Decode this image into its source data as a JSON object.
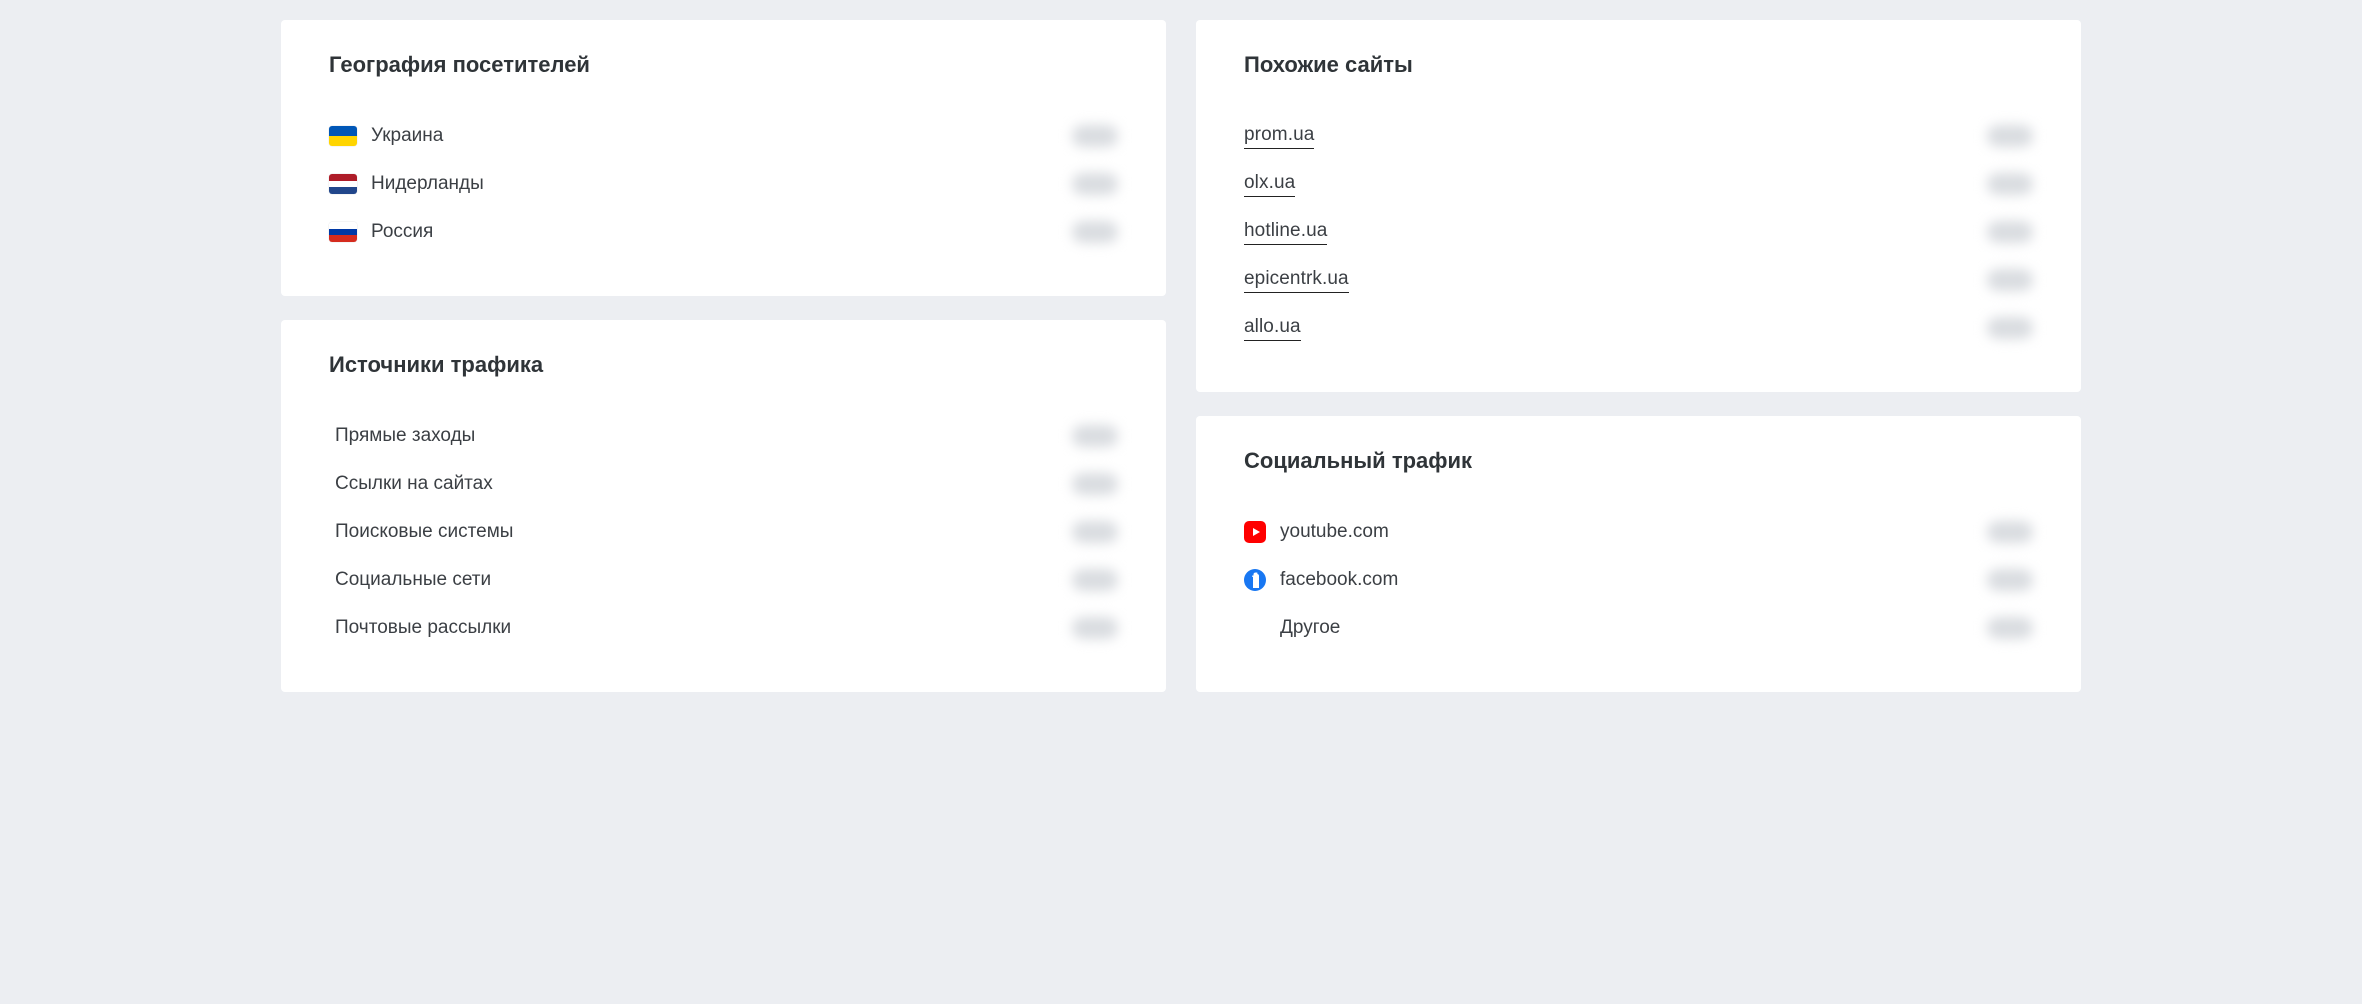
{
  "geography": {
    "title": "География посетителей",
    "items": [
      {
        "label": "Украина",
        "flag": "ua"
      },
      {
        "label": "Нидерланды",
        "flag": "nl"
      },
      {
        "label": "Россия",
        "flag": "ru"
      }
    ]
  },
  "traffic_sources": {
    "title": "Источники трафика",
    "items": [
      {
        "label": "Прямые заходы"
      },
      {
        "label": "Ссылки на сайтах"
      },
      {
        "label": "Поисковые системы"
      },
      {
        "label": "Социальные сети"
      },
      {
        "label": "Почтовые рассылки"
      }
    ]
  },
  "similar_sites": {
    "title": "Похожие сайты",
    "items": [
      {
        "label": "prom.ua"
      },
      {
        "label": "olx.ua"
      },
      {
        "label": "hotline.ua"
      },
      {
        "label": "epicentrk.ua"
      },
      {
        "label": "allo.ua"
      }
    ]
  },
  "social_traffic": {
    "title": "Социальный трафик",
    "items": [
      {
        "label": "youtube.com",
        "icon": "yt"
      },
      {
        "label": "facebook.com",
        "icon": "fb"
      },
      {
        "label": "Другое",
        "icon": ""
      }
    ]
  }
}
